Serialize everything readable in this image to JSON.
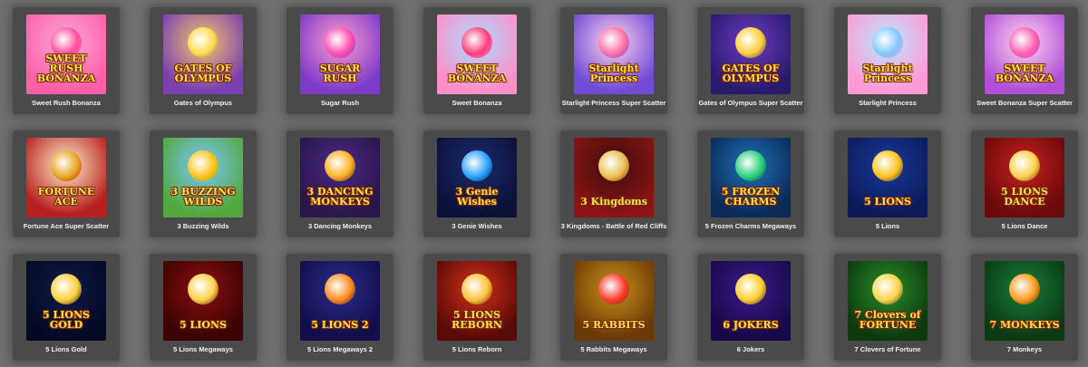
{
  "games": [
    {
      "title": "Sweet Rush Bonanza",
      "art_text": "SWEET RUSH BONANZA",
      "colors": [
        "#f8a8d8",
        "#ff5fa8",
        "#ff4f9e"
      ]
    },
    {
      "title": "Gates of Olympus",
      "art_text": "GATES OF OLYMPUS",
      "colors": [
        "#f4c56b",
        "#7a3fb0",
        "#ffd94a"
      ]
    },
    {
      "title": "Sugar Rush",
      "art_text": "SUGAR RUSH",
      "colors": [
        "#ff9ad2",
        "#7c3cc8",
        "#ff4fb0"
      ]
    },
    {
      "title": "Sweet Bonanza",
      "art_text": "SWEET BONANZA",
      "colors": [
        "#a8dcff",
        "#ff8fc8",
        "#ff3d7f"
      ]
    },
    {
      "title": "Starlight Princess Super Scatter",
      "art_text": "Starlight Princess",
      "colors": [
        "#ffd2e8",
        "#6f4bd8",
        "#ff6fa8"
      ]
    },
    {
      "title": "Gates of Olympus Super Scatter",
      "art_text": "GATES OF OLYMPUS",
      "colors": [
        "#6a3ac0",
        "#2a1a6e",
        "#ffce3a"
      ]
    },
    {
      "title": "Starlight Princess",
      "art_text": "Starlight Princess",
      "colors": [
        "#b8e6ff",
        "#ff9ad6",
        "#7fc8ff"
      ]
    },
    {
      "title": "Sweet Bonanza Super Scatter",
      "art_text": "SWEET BONANZA",
      "colors": [
        "#ffd6f0",
        "#b04fd8",
        "#ff5fb0"
      ]
    },
    {
      "title": "Fortune Ace Super Scatter",
      "art_text": "FORTUNE ACE",
      "colors": [
        "#fff0c8",
        "#b81f1f",
        "#e8a520"
      ]
    },
    {
      "title": "3 Buzzing Wilds",
      "art_text": "3 BUZZING WILDS",
      "colors": [
        "#7cc6ff",
        "#52a83c",
        "#ffc21a"
      ]
    },
    {
      "title": "3 Dancing Monkeys",
      "art_text": "3 DANCING MONKEYS",
      "colors": [
        "#4a2a88",
        "#2a1648",
        "#ffb020"
      ]
    },
    {
      "title": "3 Genie Wishes",
      "art_text": "3 Genie Wishes",
      "colors": [
        "#1a2a6e",
        "#0b1238",
        "#2aa0ff"
      ]
    },
    {
      "title": "3 Kingdoms - Battle of Red Cliffs",
      "art_text": "3 Kingdoms",
      "colors": [
        "#3a0c0c",
        "#8c1414",
        "#e8c050"
      ]
    },
    {
      "title": "5 Frozen Charms Megaways",
      "art_text": "5 FROZEN CHARMS",
      "colors": [
        "#1f6fb8",
        "#0a2a58",
        "#2ad07a"
      ]
    },
    {
      "title": "5 Lions",
      "art_text": "5 LIONS",
      "colors": [
        "#1a3a9a",
        "#0c1a5a",
        "#ffc21a"
      ]
    },
    {
      "title": "5 Lions Dance",
      "art_text": "5 LIONS DANCE",
      "colors": [
        "#c81f1f",
        "#6a0a0a",
        "#ffd04a"
      ]
    },
    {
      "title": "5 Lions Gold",
      "art_text": "5 LIONS GOLD",
      "colors": [
        "#0c1a4a",
        "#050a24",
        "#ffcf3a"
      ]
    },
    {
      "title": "5 Lions Megaways",
      "art_text": "5 LIONS",
      "colors": [
        "#8c0c0c",
        "#3a0404",
        "#ffd04a"
      ]
    },
    {
      "title": "5 Lions Megaways 2",
      "art_text": "5 LIONS 2",
      "colors": [
        "#2a2a8c",
        "#120e4a",
        "#ff8a1a"
      ]
    },
    {
      "title": "5 Lions Reborn",
      "art_text": "5 LIONS REBORN",
      "colors": [
        "#d0301a",
        "#5a0a06",
        "#ffc23a"
      ]
    },
    {
      "title": "5 Rabbits Megaways",
      "art_text": "5 RABBITS",
      "colors": [
        "#c8901a",
        "#6a3a06",
        "#ff3a2a"
      ]
    },
    {
      "title": "6 Jokers",
      "art_text": "6 JOKERS",
      "colors": [
        "#3a1a8a",
        "#18084a",
        "#ffce2a"
      ]
    },
    {
      "title": "7 Clovers of Fortune",
      "art_text": "7 Clovers of FORTUNE",
      "colors": [
        "#2a8a2a",
        "#0c3a0c",
        "#ffd44a"
      ]
    },
    {
      "title": "7 Monkeys",
      "art_text": "7 MONKEYS",
      "colors": [
        "#1a7a3a",
        "#0a3a14",
        "#ff9a1a"
      ]
    }
  ]
}
